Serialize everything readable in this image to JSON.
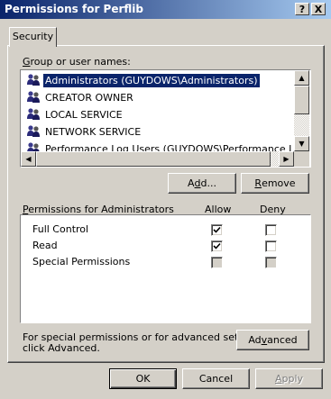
{
  "window": {
    "title": "Permissions for Perflib",
    "help_label": "?",
    "close_label": "X"
  },
  "tabs": [
    {
      "label": "Security"
    }
  ],
  "users_section": {
    "label_prefix": "G",
    "label_rest": "roup or user names:",
    "users": [
      {
        "name": "Administrators (GUYDOWS\\Administrators)",
        "selected": true
      },
      {
        "name": "CREATOR OWNER",
        "selected": false
      },
      {
        "name": "LOCAL SERVICE",
        "selected": false
      },
      {
        "name": "NETWORK SERVICE",
        "selected": false
      },
      {
        "name": "Performance Log Users (GUYDOWS\\Performance Log Us",
        "selected": false
      }
    ],
    "add_label_prefix": "A",
    "add_label_u": "d",
    "add_label_rest": "d...",
    "remove_label_u": "R",
    "remove_label_rest": "emove"
  },
  "permissions": {
    "label_u": "P",
    "label_rest": "ermissions for Administrators",
    "allow_header": "Allow",
    "deny_header": "Deny",
    "rows": [
      {
        "name": "Full Control",
        "allow": "checked",
        "deny": "unchecked"
      },
      {
        "name": "Read",
        "allow": "checked",
        "deny": "unchecked"
      },
      {
        "name": "Special Permissions",
        "allow": "disabled",
        "deny": "disabled"
      }
    ]
  },
  "advanced": {
    "text_line1": "For special permissions or for advanced settings,",
    "text_line2": "click Advanced.",
    "button_prefix": "Ad",
    "button_u": "v",
    "button_rest": "anced"
  },
  "footer": {
    "ok_label": "OK",
    "cancel_label": "Cancel",
    "apply_label_u": "A",
    "apply_label_rest": "pply"
  }
}
